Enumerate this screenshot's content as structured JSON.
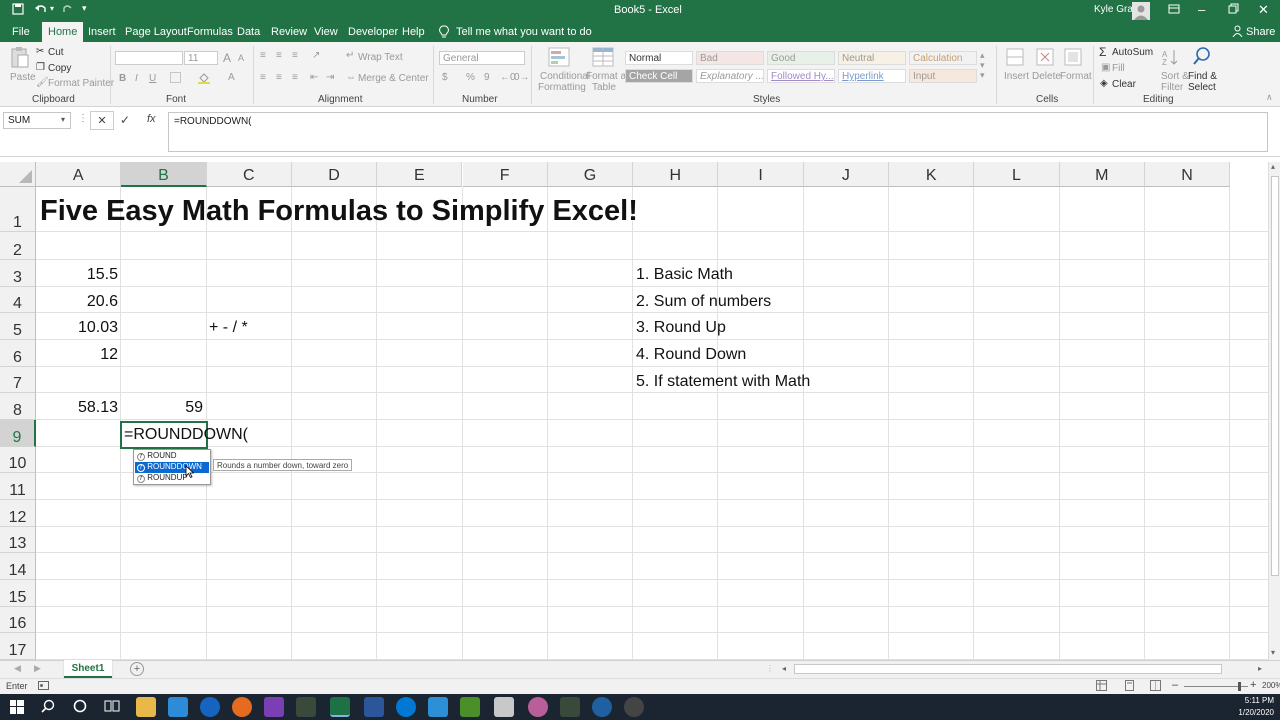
{
  "titlebar": {
    "title": "Book5  -  Excel",
    "user": "Kyle Gray",
    "colors": {
      "excel_green": "#217346"
    }
  },
  "ribbon_tabs": [
    {
      "label": "File",
      "active": false
    },
    {
      "label": "Home",
      "active": true
    },
    {
      "label": "Insert",
      "active": false
    },
    {
      "label": "Page Layout",
      "active": false
    },
    {
      "label": "Formulas",
      "active": false
    },
    {
      "label": "Data",
      "active": false
    },
    {
      "label": "Review",
      "active": false
    },
    {
      "label": "View",
      "active": false
    },
    {
      "label": "Developer",
      "active": false
    },
    {
      "label": "Help",
      "active": false
    }
  ],
  "tell_me": "Tell me what you want to do",
  "share": "Share",
  "ribbon": {
    "clipboard": {
      "paste": "Paste",
      "cut": "Cut",
      "copy": "Copy",
      "format_painter": "Format Painter",
      "label": "Clipboard"
    },
    "font": {
      "size": "11",
      "bold": "B",
      "italic": "I",
      "underline": "U",
      "grow": "A",
      "shrink": "A",
      "color": "A",
      "label": "Font"
    },
    "alignment": {
      "wrap_text": "Wrap Text",
      "merge_center": "Merge & Center",
      "label": "Alignment"
    },
    "number": {
      "format": "General",
      "currency": "$",
      "percent": "%",
      "comma": "9",
      "label": "Number"
    },
    "styles": {
      "conditional_line1": "Conditional",
      "conditional_line2": "Formatting",
      "table_line1": "Format as",
      "table_line2": "Table",
      "cells": [
        {
          "label": "Normal",
          "bg": "#ffffff",
          "fg": "#333333"
        },
        {
          "label": "Bad",
          "bg": "#f5e6e6",
          "fg": "#9a9a9a"
        },
        {
          "label": "Good",
          "bg": "#e8f1e8",
          "fg": "#9a9a9a"
        },
        {
          "label": "Neutral",
          "bg": "#f6f1e4",
          "fg": "#9a9a9a"
        },
        {
          "label": "Calculation",
          "bg": "#f2f2f2",
          "fg": "#c8a070"
        },
        {
          "label": "Check Cell",
          "bg": "#a5a5a5",
          "fg": "#ffffff"
        },
        {
          "label": "Explanatory ...",
          "bg": "#ffffff",
          "fg": "#9a9a9a"
        },
        {
          "label": "Followed Hy...",
          "bg": "#ffffff",
          "fg": "#a08cc8"
        },
        {
          "label": "Hyperlink",
          "bg": "#ffffff",
          "fg": "#7a9ad0"
        },
        {
          "label": "Input",
          "bg": "#f6e8dc",
          "fg": "#9a9a9a"
        }
      ],
      "label": "Styles"
    },
    "cells": {
      "insert": "Insert",
      "delete": "Delete",
      "format": "Format",
      "label": "Cells"
    },
    "editing": {
      "autosum": "AutoSum",
      "fill": "Fill",
      "clear": "Clear",
      "sort_line1": "Sort &",
      "sort_line2": "Filter",
      "find_line1": "Find &",
      "find_line2": "Select",
      "label": "Editing"
    }
  },
  "formula_bar": {
    "name_box": "SUM",
    "cancel": "✕",
    "enter": "✓",
    "fx": "fx",
    "content": "=ROUNDDOWN("
  },
  "columns": [
    "A",
    "B",
    "C",
    "D",
    "E",
    "F",
    "G",
    "H",
    "I",
    "J",
    "K",
    "L",
    "M",
    "N"
  ],
  "selected_column": "B",
  "rows": [
    "1",
    "2",
    "3",
    "4",
    "5",
    "6",
    "7",
    "8",
    "9",
    "10",
    "11",
    "12",
    "13",
    "14",
    "15",
    "16",
    "17"
  ],
  "selected_row": "9",
  "cells": {
    "A1": "Five Easy Math Formulas to Simplify Excel!",
    "A3": "15.5",
    "A4": "20.6",
    "A5": "10.03",
    "A6": "12",
    "A8": "58.13",
    "B8": "59",
    "C5": "+ - / *",
    "H3": "1. Basic Math",
    "H4": "2. Sum of numbers",
    "H5": "3. Round Up",
    "H6": "4. Round Down",
    "H7": "5. If statement with Math",
    "B9": "=ROUNDDOWN("
  },
  "autocomplete": {
    "items": [
      {
        "label": "ROUND",
        "selected": false
      },
      {
        "label": "ROUNDDOWN",
        "selected": true
      },
      {
        "label": "ROUNDUP",
        "selected": false
      }
    ],
    "tooltip": "Rounds a number down, toward zero"
  },
  "sheet_tab": "Sheet1",
  "status": {
    "mode": "Enter",
    "zoom": "200%"
  },
  "taskbar": {
    "time": "5:11 PM",
    "date": "1/20/2020"
  }
}
